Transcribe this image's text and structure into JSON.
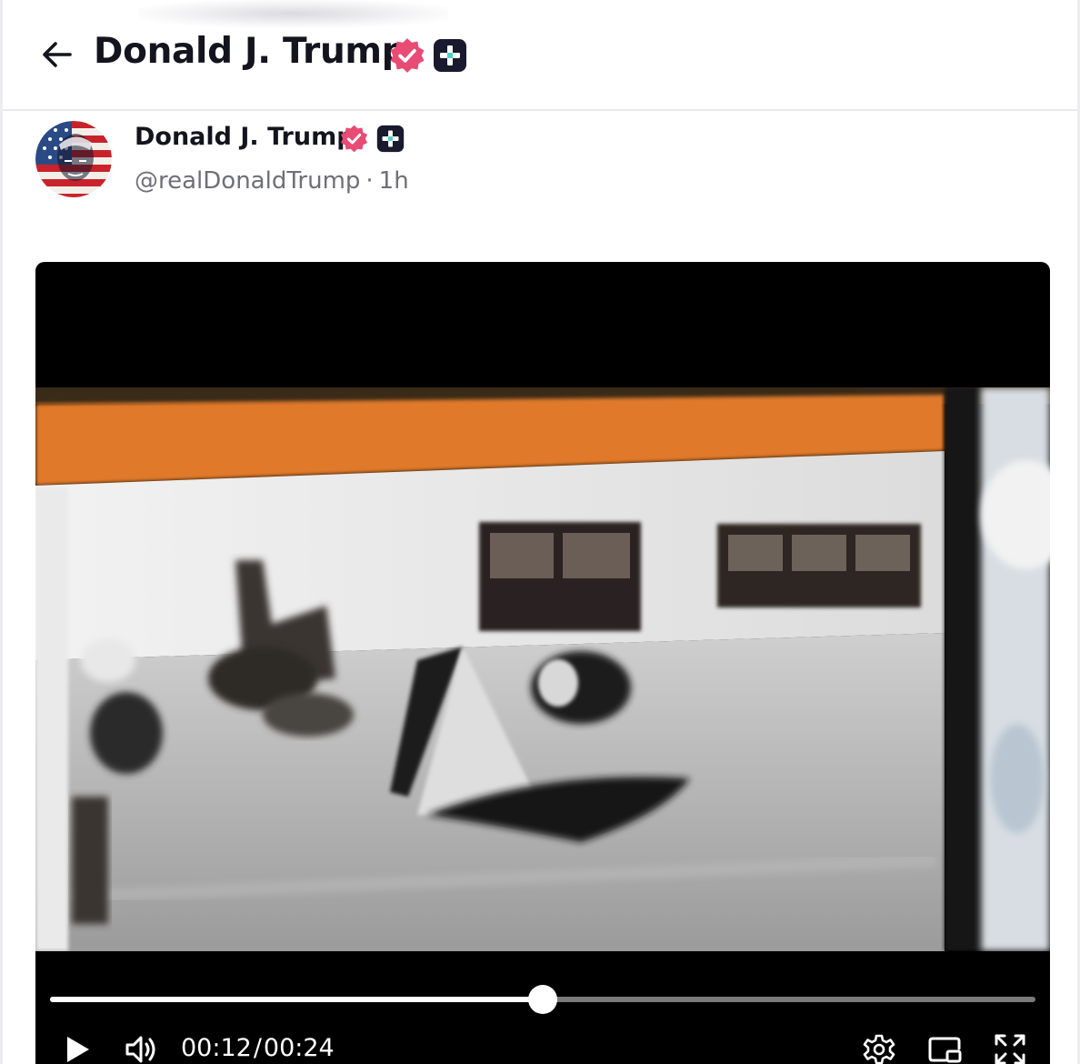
{
  "header": {
    "title": "Donald J. Trump",
    "icons": {
      "back": "arrow-left-icon",
      "verified": "verified-badge-icon",
      "plus": "truth-plus-icon"
    }
  },
  "post": {
    "author": {
      "name": "Donald J. Trump",
      "handle": "@realDonaldTrump",
      "separator": "·",
      "time_ago": "1h"
    }
  },
  "video": {
    "current_time": "00:12",
    "time_separator": "/",
    "duration": "00:24",
    "progress": 0.5,
    "controls": [
      "play-icon",
      "volume-icon",
      "settings-icon",
      "picture-in-picture-icon",
      "fullscreen-icon"
    ]
  },
  "colors": {
    "verified_badge": "#e84b74",
    "plus_badge": "#1a1a2e",
    "title_text": "#14141f",
    "muted_text": "#6f6f7a"
  }
}
